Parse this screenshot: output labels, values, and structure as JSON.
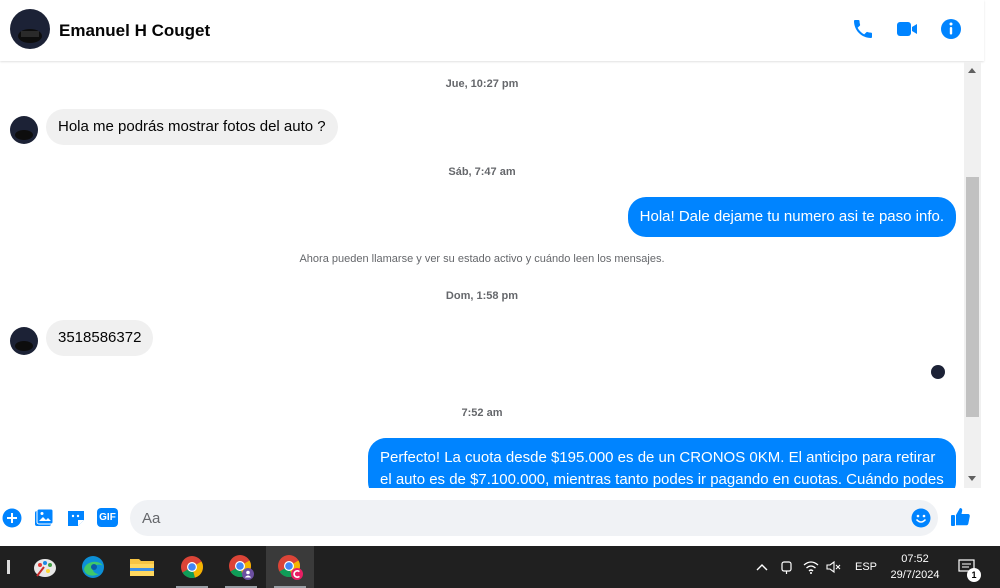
{
  "header": {
    "contact_name": "Emanuel H Couget",
    "icons": [
      "phone-icon",
      "video-camera-icon",
      "info-icon"
    ],
    "accent_color": "#0084ff"
  },
  "chat": {
    "timestamps": [
      "Jue, 10:27 pm",
      "Sáb, 7:47 am",
      "Dom, 1:58 pm",
      "7:52 am"
    ],
    "messages": [
      {
        "from": "contact",
        "text": "Hola me podrás mostrar fotos del auto ?"
      },
      {
        "from": "me",
        "text": "Hola! Dale dejame tu numero  asi te paso info."
      },
      {
        "from": "contact",
        "text": "3518586372"
      },
      {
        "from": "me",
        "text": "Perfecto! La cuota desde $195.000 es de un CRONOS 0KM. El anticipo para retirar el auto es de $7.100.000, mientras tanto podes ir pagando en cuotas. Cuándo podes"
      }
    ],
    "notice": "Ahora pueden llamarse y ver su estado activo y cuándo leen los mensajes."
  },
  "composer": {
    "placeholder": "Aa",
    "gif_label": "GIF",
    "icons": [
      "plus-icon",
      "photo-icon",
      "sticker-icon",
      "gif-icon",
      "emoji-icon",
      "thumbs-up-icon"
    ]
  },
  "taskbar": {
    "apps": [
      "paint-icon",
      "edge-icon",
      "file-explorer-icon",
      "chrome-icon",
      "chrome-profile-icon",
      "chrome-profile-c-icon"
    ],
    "language": "ESP",
    "time": "07:52",
    "date": "29/7/2024",
    "notification_count": "1"
  }
}
